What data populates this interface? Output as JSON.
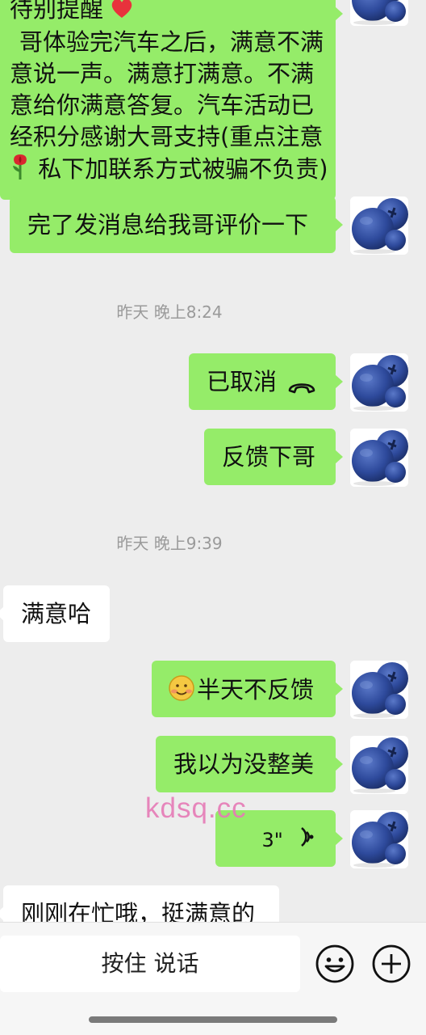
{
  "messages": {
    "m1_lines": [
      "待别提醒",
      "哥体验完汽车之后，满意不满",
      "意说一声。满意打满意。不满",
      "意给你满意答复。汽车活动已",
      "经积分感谢大哥支持(重点注意",
      "私下加联系方式被骗不负责)"
    ],
    "m2": "完了发消息给我哥评价一下",
    "t1": "昨天 晚上8:24",
    "m3": "已取消",
    "m4": "反馈下哥",
    "t2": "昨天 晚上9:39",
    "m5": "满意哈",
    "m6": "半天不反馈",
    "m7": "我以为没整美",
    "m8_duration": "3\"",
    "m9": "刚刚在忙哦，挺满意的"
  },
  "watermark": "kdsq.cc",
  "input": {
    "talk_label": "按住 说话"
  },
  "icons": {
    "emoji_button": "emoji-face-icon",
    "plus_button": "plus-icon",
    "call_cancelled": "phone-hangup-icon",
    "voice": "voice-wave-icon",
    "heart": "heart-icon",
    "rose": "rose-icon",
    "smiley": "smiley-emoji-icon",
    "avatar": "blueberry-avatar"
  },
  "colors": {
    "bubble_out": "#95ec69",
    "bubble_in": "#ffffff",
    "background": "#ededed",
    "watermark": "#e67ab6"
  }
}
